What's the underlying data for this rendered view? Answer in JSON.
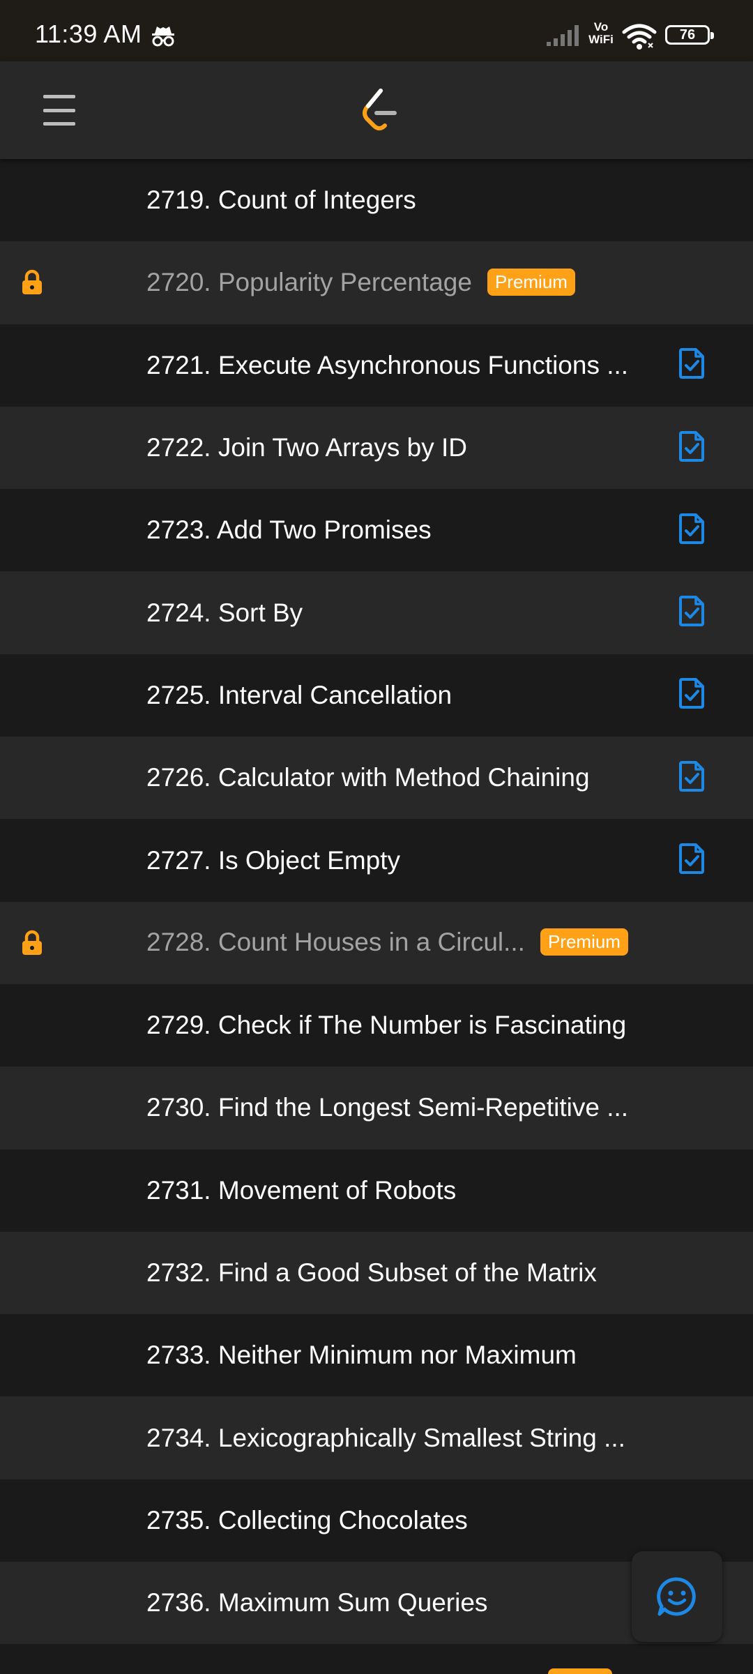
{
  "status_bar": {
    "time": "11:39 AM",
    "network_label_top": "Vo",
    "network_label_bottom": "WiFi",
    "battery": "76"
  },
  "colors": {
    "accent_orange": "#ffa116",
    "solution_blue": "#1e88e5",
    "row_dark": "#1a1a1a",
    "row_light": "#282828"
  },
  "header": {
    "menu_icon": "hamburger-menu-icon",
    "logo_icon": "leetcode-logo-icon"
  },
  "problems": [
    {
      "title": "2719. Count of Integers",
      "locked": false,
      "premium": false,
      "solution": false
    },
    {
      "title": "2720. Popularity Percentage",
      "locked": true,
      "premium": true,
      "solution": false
    },
    {
      "title": "2721. Execute Asynchronous Functions ...",
      "locked": false,
      "premium": false,
      "solution": true
    },
    {
      "title": "2722. Join Two Arrays by ID",
      "locked": false,
      "premium": false,
      "solution": true
    },
    {
      "title": "2723. Add Two Promises",
      "locked": false,
      "premium": false,
      "solution": true
    },
    {
      "title": "2724. Sort By",
      "locked": false,
      "premium": false,
      "solution": true
    },
    {
      "title": "2725. Interval Cancellation",
      "locked": false,
      "premium": false,
      "solution": true
    },
    {
      "title": "2726. Calculator with Method Chaining",
      "locked": false,
      "premium": false,
      "solution": true
    },
    {
      "title": "2727. Is Object Empty",
      "locked": false,
      "premium": false,
      "solution": true
    },
    {
      "title": "2728. Count Houses in a Circul...",
      "locked": true,
      "premium": true,
      "solution": false
    },
    {
      "title": "2729. Check if The Number is Fascinating",
      "locked": false,
      "premium": false,
      "solution": false
    },
    {
      "title": "2730. Find the Longest Semi-Repetitive ...",
      "locked": false,
      "premium": false,
      "solution": false
    },
    {
      "title": "2731. Movement of Robots",
      "locked": false,
      "premium": false,
      "solution": false
    },
    {
      "title": "2732. Find a Good Subset of the Matrix",
      "locked": false,
      "premium": false,
      "solution": false
    },
    {
      "title": "2733. Neither Minimum nor Maximum",
      "locked": false,
      "premium": false,
      "solution": false
    },
    {
      "title": "2734. Lexicographically Smallest String ...",
      "locked": false,
      "premium": false,
      "solution": false
    },
    {
      "title": "2735. Collecting Chocolates",
      "locked": false,
      "premium": false,
      "solution": false
    },
    {
      "title": "2736. Maximum Sum Queries",
      "locked": false,
      "premium": false,
      "solution": false
    }
  ],
  "premium_label": "Premium",
  "feedback_icon": "smiley-chat-icon"
}
